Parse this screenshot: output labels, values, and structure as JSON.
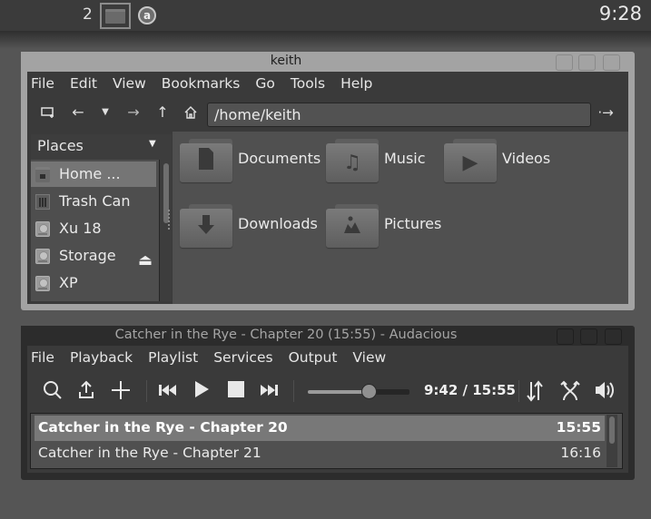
{
  "panel": {
    "workspace_number": "2",
    "tray_icon": "audacious-tray-icon",
    "clock": "9:28"
  },
  "file_manager": {
    "title": "keith",
    "menu": [
      "File",
      "Edit",
      "View",
      "Bookmarks",
      "Go",
      "Tools",
      "Help"
    ],
    "toolbar": {
      "icons": [
        "new-tab-icon",
        "back-icon",
        "history-dropdown-icon",
        "forward-icon",
        "up-icon",
        "home-icon"
      ],
      "address": "/home/keith",
      "go_icon": "go-arrow-icon"
    },
    "places": {
      "header": "Places",
      "items": [
        {
          "label": "Home ...",
          "icon": "home-folder-icon",
          "selected": true
        },
        {
          "label": "Trash Can",
          "icon": "trash-icon",
          "selected": false
        },
        {
          "label": "Xu 18",
          "icon": "drive-icon",
          "selected": false
        },
        {
          "label": "Storage",
          "icon": "drive-icon",
          "selected": false,
          "eject": true
        },
        {
          "label": "XP",
          "icon": "drive-icon",
          "selected": false
        }
      ]
    },
    "folders": [
      {
        "name": "Documents",
        "glyph": "document-icon"
      },
      {
        "name": "Music",
        "glyph": "music-icon"
      },
      {
        "name": "Videos",
        "glyph": "video-icon"
      },
      {
        "name": "Downloads",
        "glyph": "download-icon"
      },
      {
        "name": "Pictures",
        "glyph": "pictures-icon"
      }
    ]
  },
  "audacious": {
    "title": "Catcher in the Rye - Chapter 20 (15:55) - Audacious",
    "menu": [
      "File",
      "Playback",
      "Playlist",
      "Services",
      "Output",
      "View"
    ],
    "time_display": "9:42 / 15:55",
    "seek_fraction": 0.61,
    "playlist": [
      {
        "title": "Catcher in the Rye - Chapter 20",
        "duration": "15:55",
        "playing": true
      },
      {
        "title": "Catcher in the Rye - Chapter 21",
        "duration": "16:16",
        "playing": false
      }
    ]
  }
}
